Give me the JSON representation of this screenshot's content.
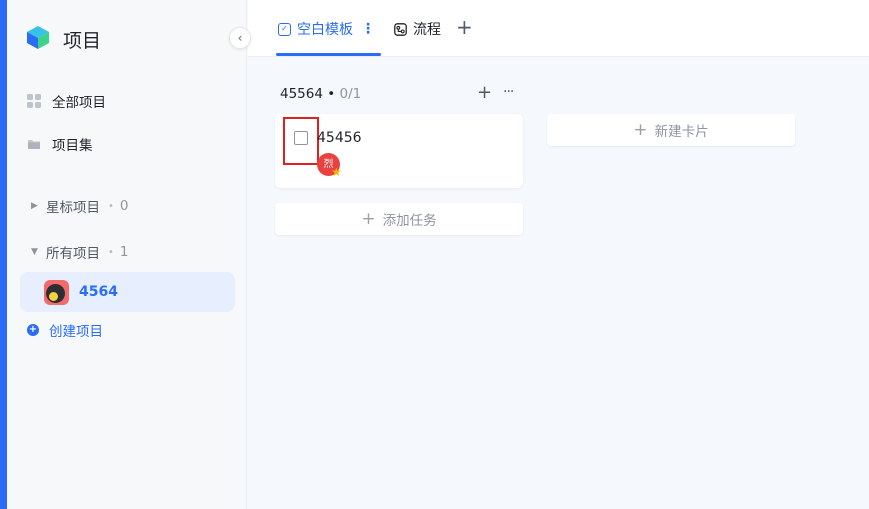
{
  "app": {
    "title": "项目"
  },
  "sidebar": {
    "nav": [
      {
        "label": "全部项目",
        "icon": "grid-icon"
      },
      {
        "label": "项目集",
        "icon": "folder-icon"
      }
    ],
    "starred": {
      "label": "星标项目",
      "count": "0"
    },
    "all": {
      "label": "所有项目",
      "count": "1"
    },
    "projects": [
      {
        "label": "4564"
      }
    ],
    "create_label": "创建项目"
  },
  "tabs": [
    {
      "label": "空白模板",
      "icon": "check-square-icon",
      "active": true
    },
    {
      "label": "流程",
      "icon": "flow-icon"
    }
  ],
  "column": {
    "name": "45564",
    "progress": "0/1",
    "cards": [
      {
        "title": "45456",
        "assignee": "烈",
        "checked": false
      }
    ],
    "add_task_label": "添加任务"
  },
  "new_card_label": "新建卡片",
  "colors": {
    "accent": "#2a6cf6",
    "avatar": "#e8413f",
    "highlight": "#e02020"
  }
}
